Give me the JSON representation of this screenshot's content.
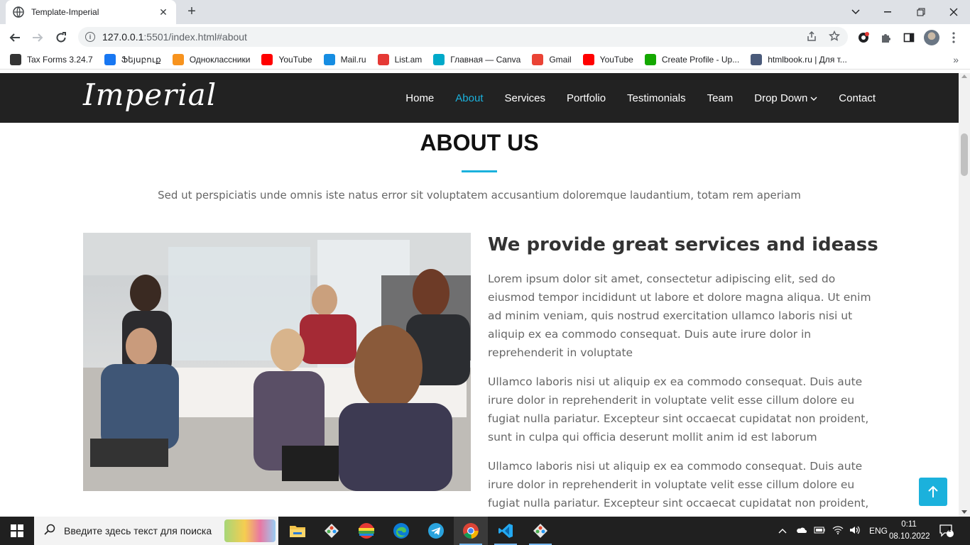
{
  "browser": {
    "tab_title": "Template-Imperial",
    "tab_close": "✕",
    "new_tab": "+",
    "url_host": "127.0.0.1",
    "url_rest": ":5501/index.html#about",
    "bookmarks": [
      {
        "label": "Tax Forms 3.24.7",
        "icon": "github-icon",
        "color": "#333333"
      },
      {
        "label": "Ֆեյսբուք",
        "icon": "facebook-icon",
        "color": "#1877f2"
      },
      {
        "label": "Одноклассники",
        "icon": "ok-icon",
        "color": "#f7931e"
      },
      {
        "label": "YouTube",
        "icon": "youtube-icon",
        "color": "#ff0000"
      },
      {
        "label": "Mail.ru",
        "icon": "mailru-icon",
        "color": "#168de2"
      },
      {
        "label": "List.am",
        "icon": "listam-icon",
        "color": "#e53935"
      },
      {
        "label": "Главная — Canva",
        "icon": "canva-icon",
        "color": "#00a9c9"
      },
      {
        "label": "Gmail",
        "icon": "gmail-icon",
        "color": "#ea4335"
      },
      {
        "label": "YouTube",
        "icon": "youtube-icon",
        "color": "#ff0000"
      },
      {
        "label": "Create Profile - Up...",
        "icon": "upwork-icon",
        "color": "#14a800"
      },
      {
        "label": "htmlbook.ru | Для т...",
        "icon": "htmlbook-icon",
        "color": "#4a5a7a"
      }
    ],
    "bookmarks_more": "»"
  },
  "site": {
    "logo": "Imperial",
    "nav": [
      {
        "label": "Home",
        "active": false
      },
      {
        "label": "About",
        "active": true
      },
      {
        "label": "Services",
        "active": false
      },
      {
        "label": "Portfolio",
        "active": false
      },
      {
        "label": "Testimonials",
        "active": false
      },
      {
        "label": "Team",
        "active": false
      },
      {
        "label": "Drop Down",
        "active": false,
        "dropdown": true
      },
      {
        "label": "Contact",
        "active": false
      }
    ],
    "accent_color": "#1bb1dc"
  },
  "about": {
    "title": "ABOUT US",
    "subtitle": "Sed ut perspiciatis unde omnis iste natus error sit voluptatem accusantium doloremque laudantium, totam rem aperiam",
    "heading": "We provide great services and ideass",
    "paragraphs": [
      "Lorem ipsum dolor sit amet, consectetur adipiscing elit, sed do eiusmod tempor incididunt ut labore et dolore magna aliqua. Ut enim ad minim veniam, quis nostrud exercitation ullamco laboris nisi ut aliquip ex ea commodo consequat. Duis aute irure dolor in reprehenderit in voluptate",
      "Ullamco laboris nisi ut aliquip ex ea commodo consequat. Duis aute irure dolor in reprehenderit in voluptate velit esse cillum dolore eu fugiat nulla pariatur. Excepteur sint occaecat cupidatat non proident, sunt in culpa qui officia deserunt mollit anim id est laborum",
      "Ullamco laboris nisi ut aliquip ex ea commodo consequat. Duis aute irure dolor in reprehenderit in voluptate velit esse cillum dolore eu fugiat nulla pariatur. Excepteur sint occaecat cupidatat non proident, sunt in culpa qui officia deserunt molli."
    ]
  },
  "taskbar": {
    "search_placeholder": "Введите здесь текст для поиска",
    "language": "ENG",
    "time": "0:11",
    "date": "08.10.2022",
    "notification_count": "1"
  }
}
